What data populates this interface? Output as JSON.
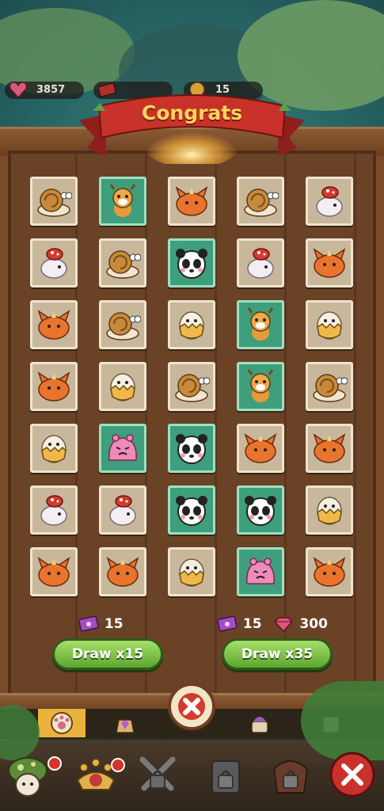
{
  "resources": {
    "hearts": "3857",
    "tickets_top": "",
    "coins": "15"
  },
  "banner": {
    "title": "Congrats"
  },
  "grid": [
    [
      "snail",
      "deer",
      "fox",
      "snail",
      "mushroom-bird"
    ],
    [
      "mushroom-bird",
      "snail",
      "panda",
      "mushroom-bird",
      "fox"
    ],
    [
      "fox",
      "snail",
      "egg-chick",
      "deer",
      "egg-chick"
    ],
    [
      "fox",
      "egg-chick",
      "snail",
      "deer",
      "snail"
    ],
    [
      "egg-chick",
      "pink-slime",
      "panda",
      "fox",
      "fox"
    ],
    [
      "mushroom-bird",
      "mushroom-bird",
      "panda",
      "panda",
      "egg-chick"
    ],
    [
      "fox",
      "fox",
      "egg-chick",
      "pink-slime",
      "fox"
    ]
  ],
  "rarity": [
    [
      "common",
      "rare",
      "common",
      "common",
      "common"
    ],
    [
      "common",
      "common",
      "rare",
      "common",
      "common"
    ],
    [
      "common",
      "common",
      "common",
      "rare",
      "common"
    ],
    [
      "common",
      "common",
      "common",
      "rare",
      "common"
    ],
    [
      "common",
      "rare",
      "rare",
      "common",
      "common"
    ],
    [
      "common",
      "common",
      "rare",
      "rare",
      "common"
    ],
    [
      "common",
      "common",
      "common",
      "rare",
      "common"
    ]
  ],
  "draw15": {
    "ticket_cost": "15",
    "label": "Draw x15"
  },
  "draw35": {
    "ticket_cost": "15",
    "gem_cost": "300",
    "label": "Draw x35"
  },
  "icons": {
    "ticket": "ticket-icon",
    "gem": "gem-icon",
    "close": "close-icon",
    "tabs": [
      "paw-tab-icon",
      "gem-bag-tab-icon",
      "creature-tab-icon",
      "locked-tab-icon"
    ],
    "nav": [
      "mushroom-hero-icon",
      "paw-crown-icon",
      "crossed-swords-icon",
      "locked-tower-icon",
      "locked-shrine-icon",
      "close-icon"
    ]
  },
  "colors": {
    "rare": "#3f9e7c",
    "common": "#c8b79b",
    "button": "#7cc241",
    "banner": "#c8322a",
    "title": "#ffd35e"
  }
}
